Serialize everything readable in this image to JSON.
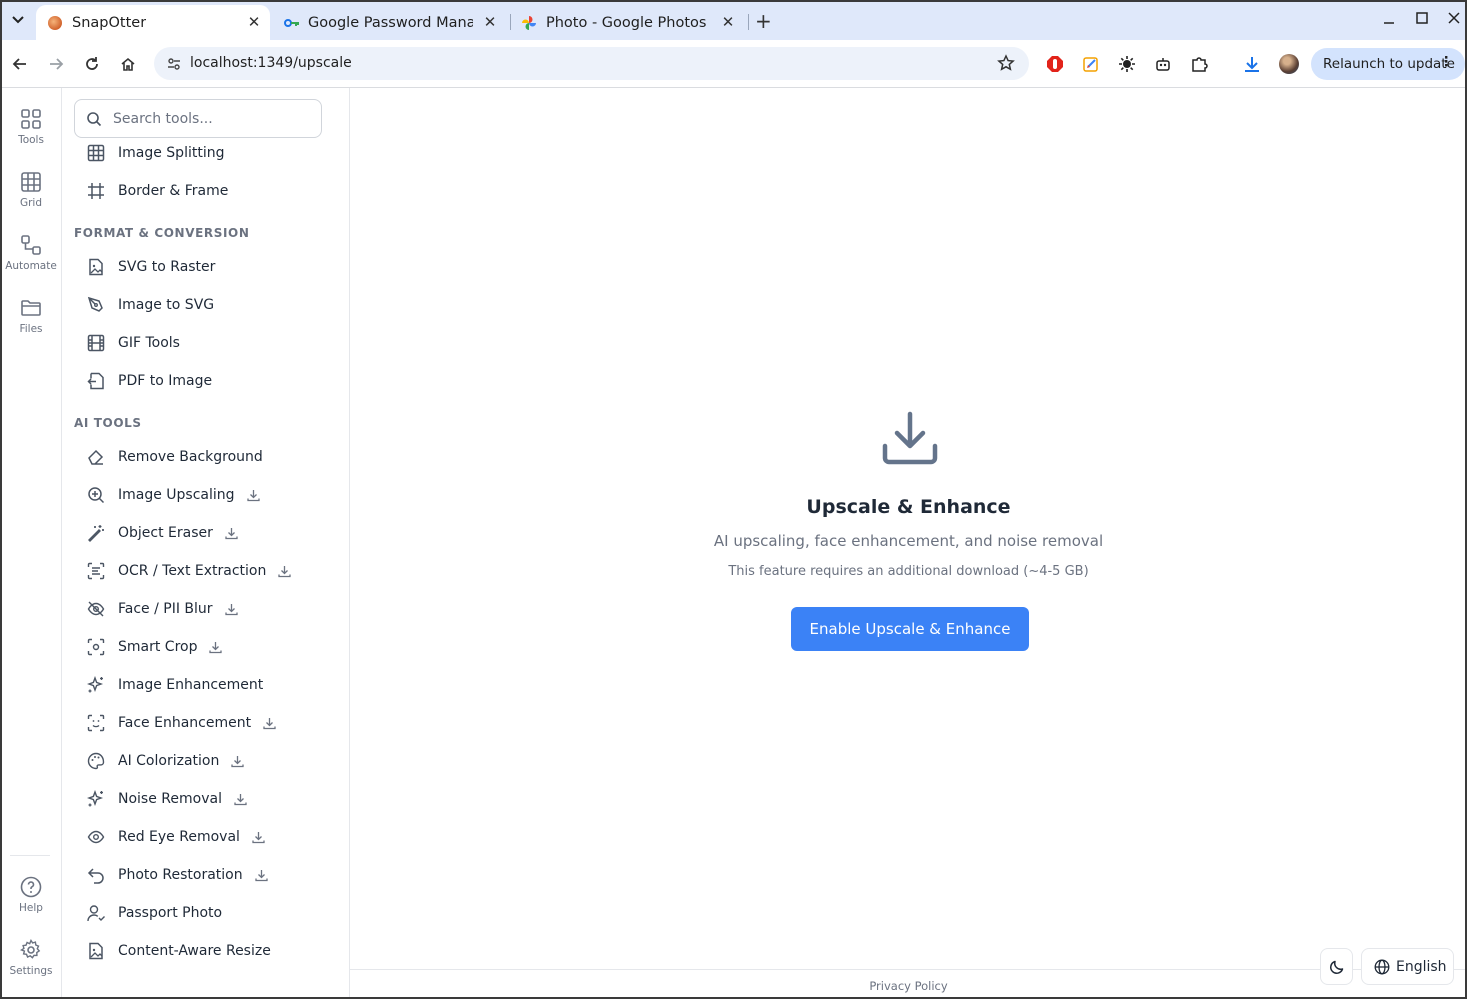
{
  "browser": {
    "tabs": [
      {
        "title": "SnapOtter",
        "active": true
      },
      {
        "title": "Google Password Manag",
        "active": false
      },
      {
        "title": "Photo - Google Photos",
        "active": false
      }
    ],
    "url": "localhost:1349/upscale",
    "relaunch_label": "Relaunch to update"
  },
  "rail": {
    "items": [
      {
        "label": "Tools",
        "icon": "grid-four-icon"
      },
      {
        "label": "Grid",
        "icon": "grid-icon"
      },
      {
        "label": "Automate",
        "icon": "workflow-icon"
      },
      {
        "label": "Files",
        "icon": "folder-icon"
      }
    ],
    "bottom": [
      {
        "label": "Help",
        "icon": "help-icon"
      },
      {
        "label": "Settings",
        "icon": "gear-icon"
      }
    ]
  },
  "panel": {
    "search_placeholder": "Search tools...",
    "pre_items": [
      {
        "label": "Image Splitting",
        "icon": "grid-icon"
      },
      {
        "label": "Border & Frame",
        "icon": "frame-icon"
      }
    ],
    "sections": [
      {
        "title": "FORMAT & CONVERSION",
        "items": [
          {
            "label": "SVG to Raster",
            "icon": "file-image-icon",
            "download": false
          },
          {
            "label": "Image to SVG",
            "icon": "pen-tool-icon",
            "download": false
          },
          {
            "label": "GIF Tools",
            "icon": "film-icon",
            "download": false
          },
          {
            "label": "PDF to Image",
            "icon": "file-export-icon",
            "download": false
          }
        ]
      },
      {
        "title": "AI TOOLS",
        "items": [
          {
            "label": "Remove Background",
            "icon": "eraser-icon",
            "download": false
          },
          {
            "label": "Image Upscaling",
            "icon": "zoom-in-icon",
            "download": true
          },
          {
            "label": "Object Eraser",
            "icon": "magic-wand-icon",
            "download": true
          },
          {
            "label": "OCR / Text Extraction",
            "icon": "scan-text-icon",
            "download": true
          },
          {
            "label": "Face / PII Blur",
            "icon": "eye-off-icon",
            "download": true
          },
          {
            "label": "Smart Crop",
            "icon": "focus-icon",
            "download": true
          },
          {
            "label": "Image Enhancement",
            "icon": "sparkles-icon",
            "download": false
          },
          {
            "label": "Face Enhancement",
            "icon": "scan-face-icon",
            "download": true
          },
          {
            "label": "AI Colorization",
            "icon": "palette-icon",
            "download": true
          },
          {
            "label": "Noise Removal",
            "icon": "sparkles-icon",
            "download": true
          },
          {
            "label": "Red Eye Removal",
            "icon": "eye-icon",
            "download": true
          },
          {
            "label": "Photo Restoration",
            "icon": "undo-icon",
            "download": true
          },
          {
            "label": "Passport Photo",
            "icon": "user-icon",
            "download": false
          },
          {
            "label": "Content-Aware Resize",
            "icon": "file-image-icon",
            "download": false
          }
        ]
      }
    ]
  },
  "main": {
    "title": "Upscale & Enhance",
    "subtitle": "AI upscaling, face enhancement, and noise removal",
    "note": "This feature requires an additional download (~4-5 GB)",
    "button": "Enable Upscale & Enhance",
    "footer_link": "Privacy Policy",
    "language": "English"
  },
  "colors": {
    "accent": "#3b82f6",
    "tabstrip": "#dfe8fa",
    "relaunch": "#d3e3fd"
  }
}
